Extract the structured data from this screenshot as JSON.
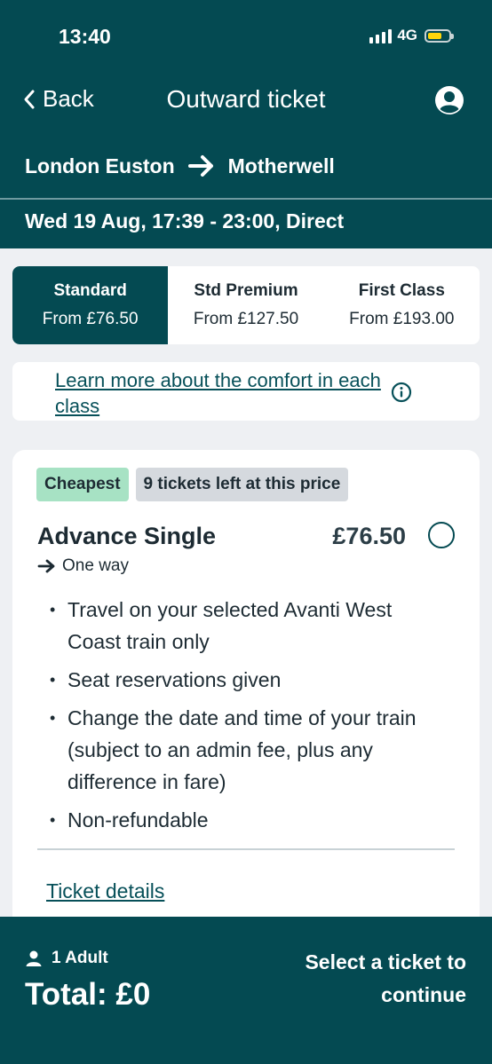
{
  "status_bar": {
    "time": "13:40",
    "network": "4G"
  },
  "nav": {
    "back_label": "Back",
    "title": "Outward ticket"
  },
  "journey": {
    "origin": "London Euston",
    "destination": "Motherwell",
    "summary": "Wed 19 Aug, 17:39 - 23:00, Direct"
  },
  "class_tabs": [
    {
      "name": "Standard",
      "price": "From £76.50",
      "selected": true
    },
    {
      "name": "Std Premium",
      "price": "From £127.50",
      "selected": false
    },
    {
      "name": "First Class",
      "price": "From £193.00",
      "selected": false
    }
  ],
  "learn_more": {
    "text": "Learn more about the comfort in each class"
  },
  "fare_card": {
    "badges": [
      "Cheapest",
      "9 tickets left at this price"
    ],
    "name": "Advance Single",
    "price": "£76.50",
    "direction": "One way",
    "features": [
      "Travel on your selected Avanti West Coast train only",
      "Seat reservations given",
      "Change the date and time of your train (subject to an admin fee, plus any difference in fare)",
      "Non-refundable"
    ],
    "details_link": "Ticket details"
  },
  "footer": {
    "passengers": "1 Adult",
    "total": "Total: £0",
    "cta": "Select a ticket to continue"
  },
  "colors": {
    "brand": "#044a52",
    "cheapest_badge": "#a7e2c4",
    "availability_badge": "#d5d9de",
    "battery": "#ffd60a"
  },
  "icons": [
    "chevron-left-icon",
    "account-icon",
    "arrow-right-icon",
    "info-icon",
    "person-icon",
    "radio-icon"
  ]
}
